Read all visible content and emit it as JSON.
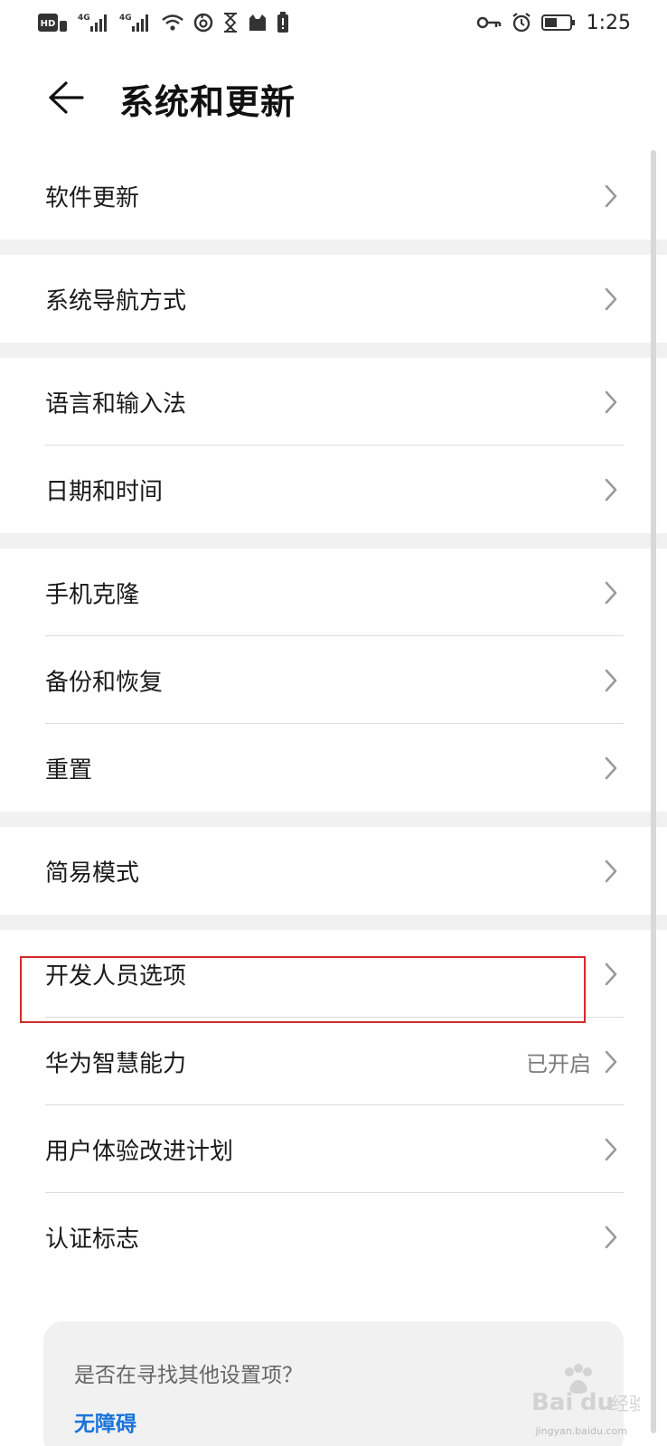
{
  "status_bar": {
    "time": "1:25",
    "left_icons": [
      "hd-icon",
      "signal-4g-icon",
      "signal-4g-icon",
      "wifi-icon",
      "netease-icon",
      "hourglass-icon",
      "cat-icon",
      "battery-alert-icon"
    ],
    "right_icons": [
      "key-icon",
      "alarm-icon",
      "battery-icon"
    ],
    "hd_label": "HD",
    "net1_label": "4G",
    "net2_label": "4G"
  },
  "header": {
    "title": "系统和更新"
  },
  "groups": [
    {
      "items": [
        {
          "label": "软件更新"
        }
      ]
    },
    {
      "items": [
        {
          "label": "系统导航方式"
        }
      ]
    },
    {
      "items": [
        {
          "label": "语言和输入法"
        },
        {
          "label": "日期和时间"
        }
      ]
    },
    {
      "items": [
        {
          "label": "手机克隆"
        },
        {
          "label": "备份和恢复"
        },
        {
          "label": "重置"
        }
      ]
    },
    {
      "items": [
        {
          "label": "简易模式"
        }
      ]
    },
    {
      "items": [
        {
          "label": "开发人员选项",
          "highlighted": true
        },
        {
          "label": "华为智慧能力",
          "value": "已开启"
        },
        {
          "label": "用户体验改进计划"
        },
        {
          "label": "认证标志"
        }
      ]
    }
  ],
  "suggestion": {
    "question": "是否在寻找其他设置项？",
    "link": "无障碍"
  },
  "watermark": {
    "logo_text": "Baidu经验",
    "url": "jingyan.baidu.com"
  },
  "colors": {
    "highlight": "#d42a2a",
    "link": "#1a74d9",
    "group_gap": "#f1f1f1"
  }
}
